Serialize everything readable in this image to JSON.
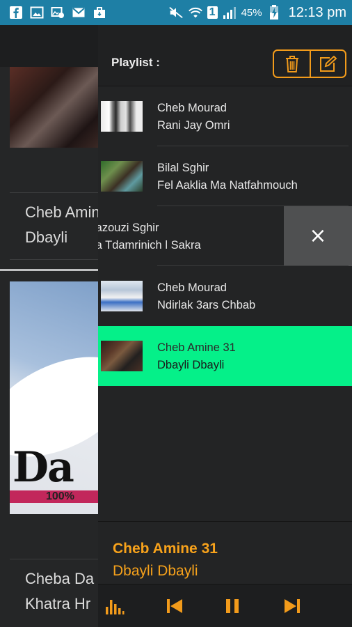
{
  "status_bar": {
    "battery": "45%",
    "sim": "1",
    "time": "12:13 pm",
    "icons": [
      "facebook-icon",
      "gallery-icon",
      "image-icon",
      "mail-icon",
      "bag-icon",
      "mute-icon",
      "wifi-icon",
      "signal-icon",
      "battery-charging-icon"
    ]
  },
  "background": {
    "card1": {
      "artist": "Cheb Amine",
      "song": "Dbayli"
    },
    "card2": {
      "artist": "Cheba Da",
      "song": "Khatra Hr"
    },
    "thumb2_text": "Da",
    "thumb2_pct": "100%"
  },
  "playlist": {
    "title": "Playlist :",
    "tracks": [
      {
        "artist": "Cheb Mourad",
        "song": "Rani Jay Omri"
      },
      {
        "artist": "Bilal Sghir",
        "song": "Fel Aaklia Ma Natfahmouch"
      },
      {
        "artist": "lazouzi Sghir",
        "song": "la Tdamrinich l Sakra"
      },
      {
        "artist": "Cheb Mourad",
        "song": "Ndirlak 3ars Chbab"
      },
      {
        "artist": "Cheb Amine 31",
        "song": "Dbayli Dbayli"
      }
    ],
    "active_index": 4,
    "delete_label": "×"
  },
  "now_playing": {
    "artist": "Cheb Amine 31",
    "song": "Dbayli Dbayli"
  },
  "colors": {
    "status_bar": "#1e7fa5",
    "accent": "#f29b1b",
    "active_row": "#05f089",
    "now_playing": "#f7a21b"
  }
}
